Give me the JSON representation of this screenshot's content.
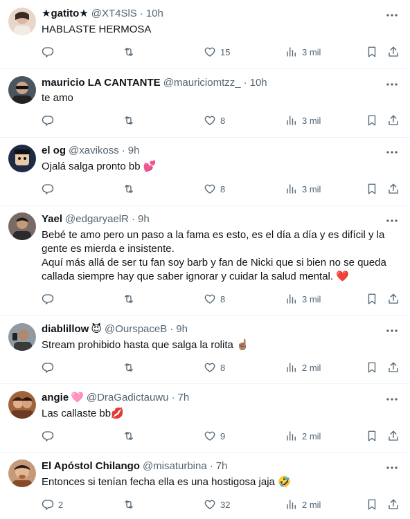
{
  "tweets": [
    {
      "name": "★gatito★",
      "badge": "",
      "handle": "@XT4SlS",
      "sep": "·",
      "time": "10h",
      "text": "HABLASTE HERMOSA",
      "replies": "",
      "reposts": "",
      "likes": "15",
      "views": "3 mil",
      "avatar_color": "#e8d6c8"
    },
    {
      "name": "mauricio LA CANTANTE",
      "badge": "",
      "handle": "@mauriciomtzz_",
      "sep": "·",
      "time": "10h",
      "text": "te amo",
      "replies": "",
      "reposts": "",
      "likes": "8",
      "views": "3 mil",
      "avatar_color": "#4a5560"
    },
    {
      "name": "el og",
      "badge": "",
      "handle": "@xavikoss",
      "sep": "·",
      "time": "9h",
      "text": "Ojalá salga pronto bb 💕",
      "replies": "",
      "reposts": "",
      "likes": "8",
      "views": "3 mil",
      "avatar_color": "#1f2a44"
    },
    {
      "name": "Yael",
      "badge": "",
      "handle": "@edgaryaelR",
      "sep": "·",
      "time": "9h",
      "text": "Bebé te amo pero un paso a la fama es esto, es el día a día y es difícil y la gente es mierda e insistente.\nAquí más allá de ser tu fan soy barb y fan de Nicki que si bien no se queda callada siempre hay que saber ignorar y cuidar la salud mental. ❤️",
      "replies": "",
      "reposts": "",
      "likes": "8",
      "views": "3 mil",
      "avatar_color": "#7a6a66"
    },
    {
      "name": "diablillow",
      "badge": "😈",
      "handle": "@OurspaceB",
      "sep": "·",
      "time": "9h",
      "text": "Stream prohibido hasta que salga la rolita ☝🏽",
      "replies": "",
      "reposts": "",
      "likes": "8",
      "views": "2 mil",
      "avatar_color": "#8f9aa3"
    },
    {
      "name": "angie",
      "badge": "🩷",
      "handle": "@DraGadictauwu",
      "sep": "·",
      "time": "7h",
      "text": "Las callaste bb💋",
      "replies": "",
      "reposts": "",
      "likes": "9",
      "views": "2 mil",
      "avatar_color": "#a0643c"
    },
    {
      "name": "El Apóstol Chilango",
      "badge": "",
      "handle": "@misaturbina",
      "sep": "·",
      "time": "7h",
      "text": "Entonces si tenían fecha ella es una hostigosa jaja 🤣",
      "replies": "2",
      "reposts": "",
      "likes": "32",
      "views": "2 mil",
      "avatar_color": "#c49a7a"
    }
  ],
  "colors": {
    "text": "#0f1419",
    "secondary": "#536471",
    "divider": "#eff3f4",
    "heart_emoji": "#e0245e"
  },
  "icons": {
    "reply": "reply-icon",
    "repost": "repost-icon",
    "like": "like-icon",
    "views": "views-icon",
    "bookmark": "bookmark-icon",
    "share": "share-icon",
    "more": "more-icon"
  }
}
